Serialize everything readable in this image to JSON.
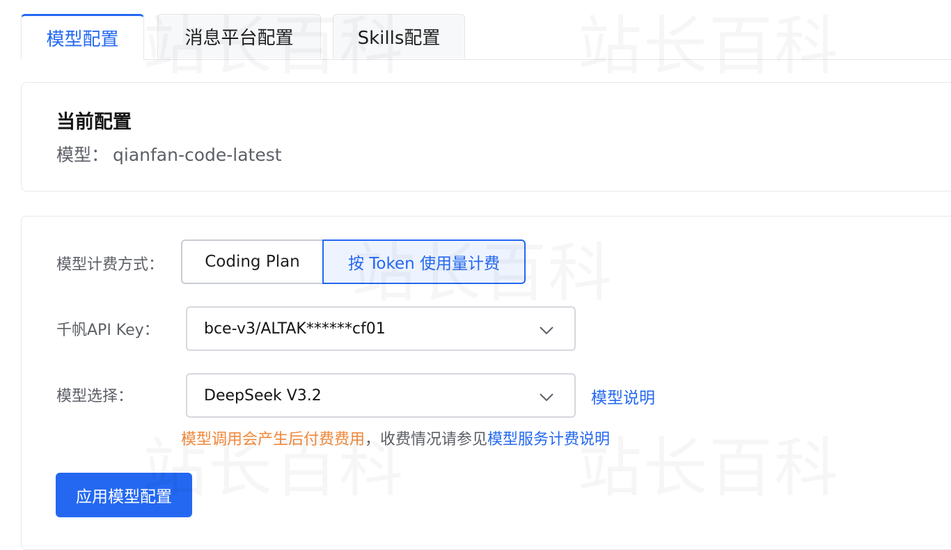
{
  "tabs": [
    {
      "label": "模型配置",
      "active": true
    },
    {
      "label": "消息平台配置",
      "active": false
    },
    {
      "label": "Skills配置",
      "active": false
    }
  ],
  "current_config": {
    "title": "当前配置",
    "model_label": "模型：",
    "model_value": "qianfan-code-latest"
  },
  "form": {
    "billing_label": "模型计费方式：",
    "billing_options": [
      "Coding Plan",
      "按 Token 使用量计费"
    ],
    "billing_selected": "按 Token 使用量计费",
    "api_key_label": "千帆API Key：",
    "api_key_value": "bce-v3/ALTAK******cf01",
    "model_select_label": "模型选择：",
    "model_select_value": "DeepSeek V3.2",
    "model_doc_link": "模型说明",
    "notice_warn": "模型调用会产生后付费费用",
    "notice_mid": "，收费情况请参见",
    "notice_link": "模型服务计费说明",
    "apply_button": "应用模型配置"
  },
  "watermark_text": "站长百科",
  "colors": {
    "primary": "#2468f2",
    "warning": "#f2883a",
    "border": "#e3e6eb",
    "muted_text": "#5c5f66"
  }
}
